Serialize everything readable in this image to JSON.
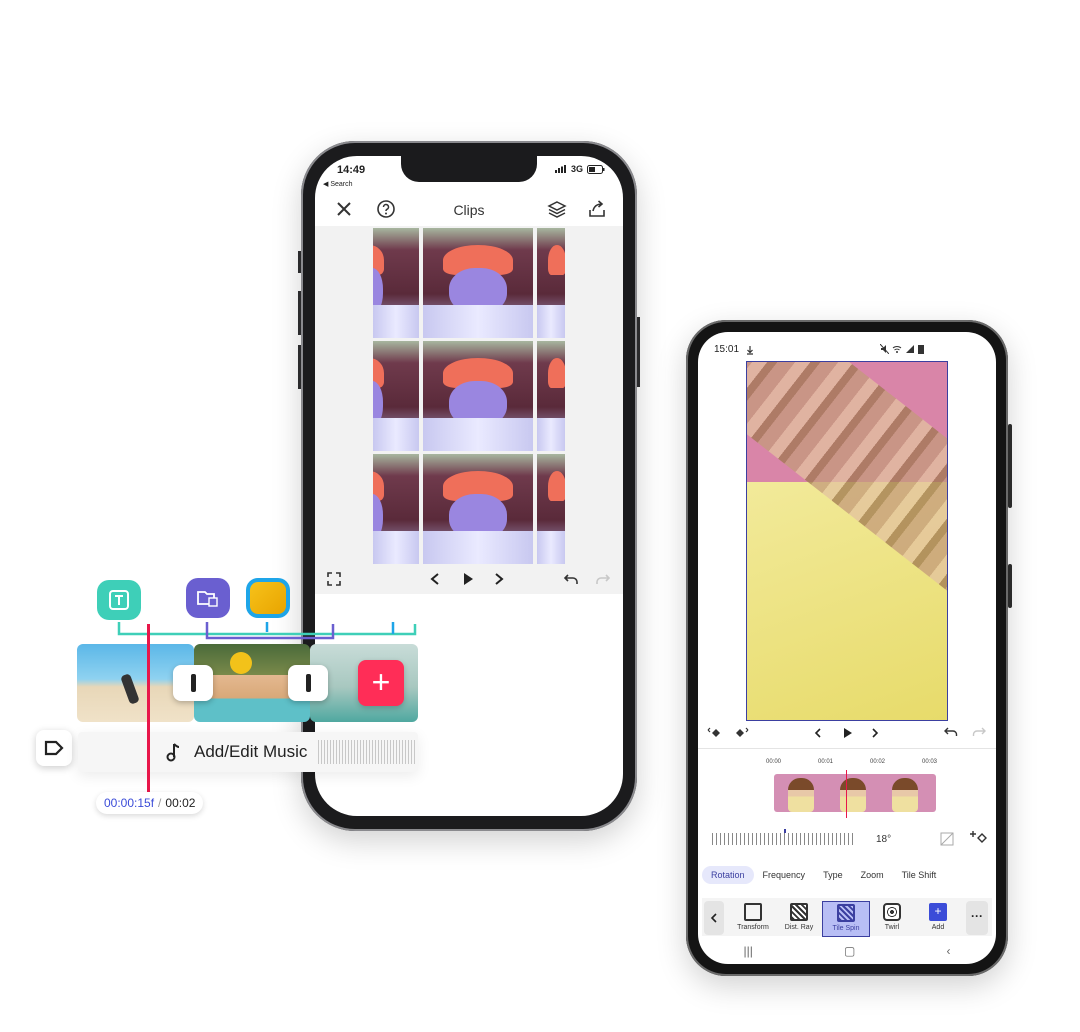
{
  "ios": {
    "status": {
      "time": "14:49",
      "back": "◀ Search",
      "network": "3G"
    },
    "nav": {
      "title": "Clips"
    }
  },
  "android": {
    "status": {
      "time": "15:01"
    },
    "ruler": {
      "ticks": [
        "00:00",
        "00:01",
        "00:02",
        "00:03"
      ],
      "angle": "18°"
    },
    "tabs": [
      {
        "label": "Rotation",
        "active": true
      },
      {
        "label": "Frequency",
        "active": false
      },
      {
        "label": "Type",
        "active": false
      },
      {
        "label": "Zoom",
        "active": false
      },
      {
        "label": "Tile Shift",
        "active": false
      }
    ],
    "tools": [
      {
        "label": "Transform",
        "active": false
      },
      {
        "label": "Dist. Ray",
        "active": false
      },
      {
        "label": "Tile Spin",
        "active": true
      },
      {
        "label": "Twirl",
        "active": false
      },
      {
        "label": "Add",
        "active": false
      }
    ]
  },
  "overlay": {
    "music_label": "Add/Edit Music",
    "time_current": "00:00:15f",
    "time_separator": "/",
    "time_total": "00:02",
    "colors": {
      "text_badge": "#3ecfb8",
      "layer_badge": "#6a5fd0",
      "effect_badge": "#1ea5e8",
      "playhead": "#e8174a",
      "add": "#ff2d57"
    }
  }
}
